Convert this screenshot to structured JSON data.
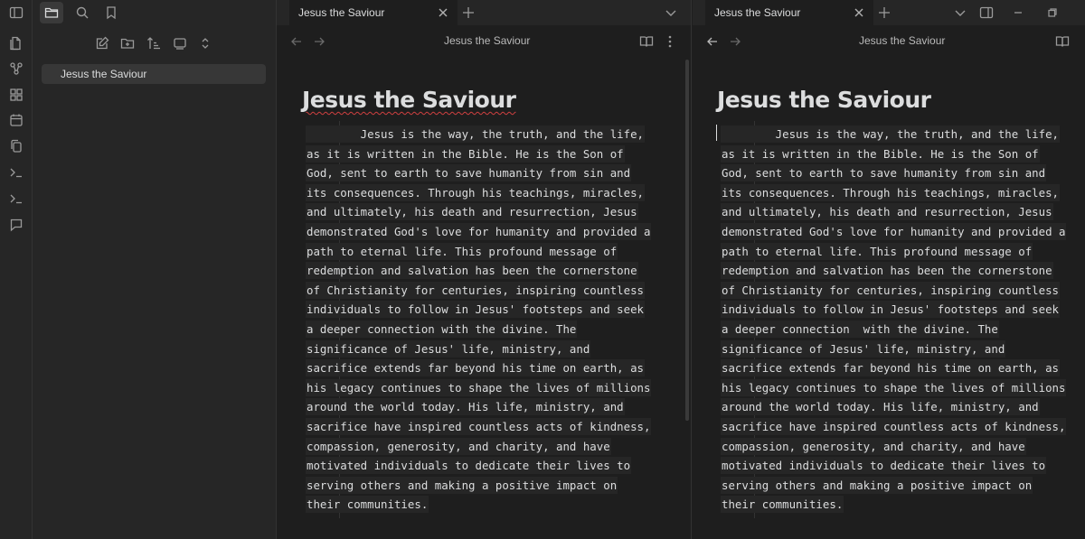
{
  "window": {
    "title": "Jesus the Saviour"
  },
  "ribbon": {
    "icons": [
      "sidebar-toggle-icon",
      "files-icon",
      "graph-icon",
      "canvas-icon",
      "calendar-icon",
      "copy-icon",
      "terminal-icon",
      "terminal-icon",
      "comment-icon"
    ]
  },
  "sidebar": {
    "files": [
      {
        "name": "Jesus the Saviour"
      }
    ]
  },
  "pane1": {
    "tab_title": "Jesus the Saviour",
    "header_title": "Jesus the Saviour",
    "doc_title": "Jesus the Saviour",
    "lines": [
      "        Jesus is the way, the truth, and the life,",
      "as it is written in the Bible. He is the Son of",
      "God, sent to earth to save humanity from sin and",
      "its consequences. Through his teachings, miracles,",
      "and ultimately, his death and resurrection, Jesus",
      "demonstrated God's love for humanity and provided a",
      "path to eternal life. This profound message of",
      "redemption and salvation has been the cornerstone",
      "of Christianity for centuries, inspiring countless",
      "individuals to follow in Jesus' footsteps and seek",
      "a deeper connection with the divine. The",
      "significance of Jesus' life, ministry, and",
      "sacrifice extends far beyond his time on earth, as",
      "his legacy continues to shape the lives of millions",
      "around the world today. His life, ministry, and",
      "sacrifice have inspired countless acts of kindness,",
      "compassion, generosity, and charity, and have",
      "motivated individuals to dedicate their lives to",
      "serving others and making a positive impact on",
      "their communities."
    ]
  },
  "pane2": {
    "tab_title": "Jesus the Saviour",
    "header_title": "Jesus the Saviour",
    "doc_title": "Jesus the Saviour",
    "lines": [
      "        Jesus is the way, the truth, and the life,",
      "as it is written in the Bible. He is the Son of",
      "God, sent to earth to save humanity from sin and",
      "its consequences. Through his teachings, miracles,",
      "and ultimately, his death and resurrection, Jesus",
      "demonstrated God's love for humanity and provided a",
      "path to eternal life. This profound message of",
      "redemption and salvation has been the cornerstone",
      "of Christianity for centuries, inspiring countless",
      "individuals to follow in Jesus' footsteps and seek",
      "a deeper connection  with the divine. The",
      "significance of Jesus' life, ministry, and",
      "sacrifice extends far beyond his time on earth, as",
      "his legacy continues to shape the lives of millions",
      "around the world today. His life, ministry, and",
      "sacrifice have inspired countless acts of kindness,",
      "compassion, generosity, and charity, and have",
      "motivated individuals to dedicate their lives to",
      "serving others and making a positive impact on",
      "their communities."
    ]
  },
  "colors": {
    "background": "#1e1e1e",
    "sidebar": "#262626",
    "text": "#dcddde",
    "spellcheck": "#d04040"
  }
}
